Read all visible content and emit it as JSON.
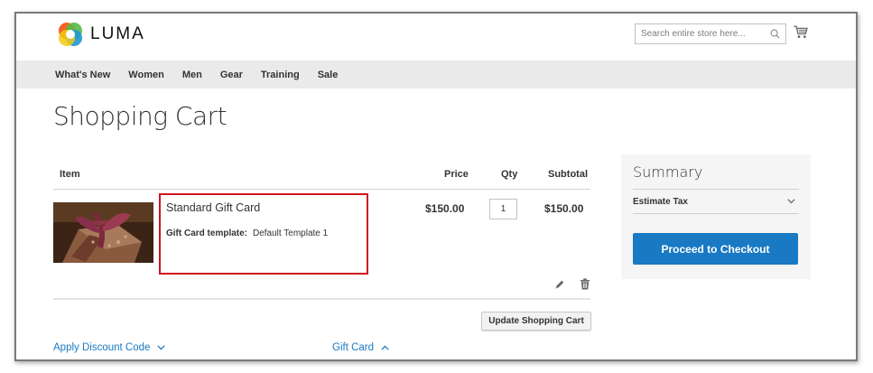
{
  "header": {
    "logo_text": "LUMA",
    "search_placeholder": "Search entire store here..."
  },
  "nav": {
    "items": [
      "What's New",
      "Women",
      "Men",
      "Gear",
      "Training",
      "Sale"
    ]
  },
  "page_title": "Shopping Cart",
  "cart": {
    "columns": {
      "item": "Item",
      "price": "Price",
      "qty": "Qty",
      "subtotal": "Subtotal"
    },
    "rows": [
      {
        "name": "Standard Gift Card",
        "option_label": "Gift Card template:",
        "option_value": "Default Template 1",
        "price": "$150.00",
        "qty": "1",
        "subtotal": "$150.00"
      }
    ],
    "update_button": "Update Shopping Cart",
    "discount_link": "Apply Discount Code",
    "gift_card_link": "Gift Card"
  },
  "summary": {
    "title": "Summary",
    "estimate_tax": "Estimate Tax",
    "checkout_button": "Proceed to Checkout"
  },
  "colors": {
    "accent": "#1979c3",
    "highlight": "#d0141e",
    "nav_bg": "#eaeaea",
    "summary_bg": "#f5f5f5"
  }
}
